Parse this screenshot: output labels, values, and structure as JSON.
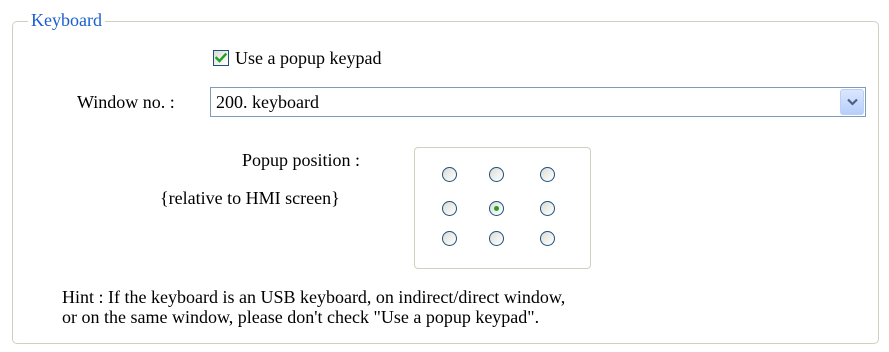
{
  "groupbox": {
    "title": "Keyboard"
  },
  "popup_keypad": {
    "label": "Use a popup keypad",
    "checked": true
  },
  "window": {
    "label": "Window no. :",
    "selected": "200. keyboard"
  },
  "position": {
    "label": "Popup position :",
    "sublabel": "{relative to HMI screen}",
    "options": [
      {
        "name": "top-left",
        "selected": false
      },
      {
        "name": "top-center",
        "selected": false
      },
      {
        "name": "top-right",
        "selected": false
      },
      {
        "name": "middle-left",
        "selected": false
      },
      {
        "name": "middle-center",
        "selected": true
      },
      {
        "name": "middle-right",
        "selected": false
      },
      {
        "name": "bottom-left",
        "selected": false
      },
      {
        "name": "bottom-center",
        "selected": false
      },
      {
        "name": "bottom-right",
        "selected": false
      }
    ]
  },
  "hint": {
    "line1": "Hint : If the keyboard is an USB keyboard, on indirect/direct window,",
    "line2": "or on the same window, please don't check \"Use a popup keypad\"."
  },
  "colors": {
    "legend": "#1a5fd0",
    "border": "#d0d0bf",
    "check": "#21a121",
    "control_border": "#1c5180"
  }
}
